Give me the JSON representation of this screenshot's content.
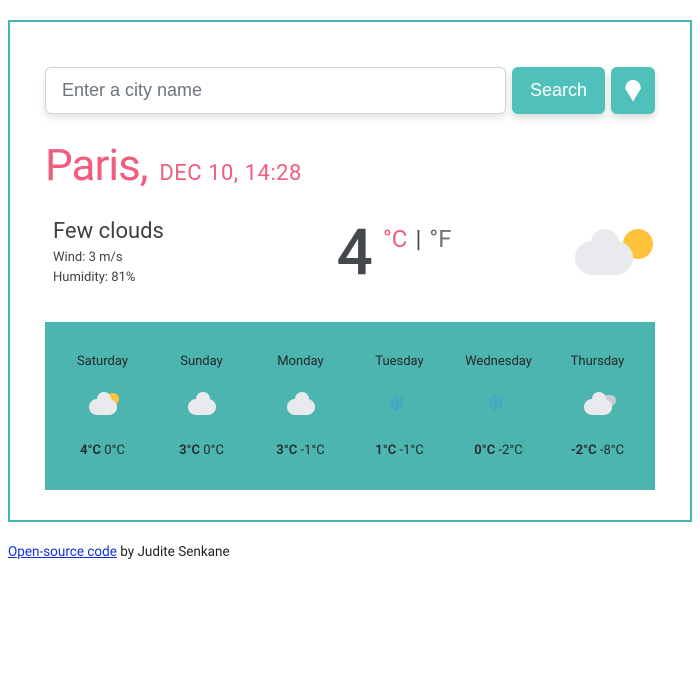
{
  "search": {
    "placeholder": "Enter a city name",
    "button_label": "Search"
  },
  "location": {
    "city": "Paris",
    "datetime": "DEC 10, 14:28"
  },
  "current": {
    "condition": "Few clouds",
    "wind_label": "Wind: 3 m/s",
    "humidity_label": "Humidity: 81%",
    "temperature": "4",
    "unit_c": "°C",
    "unit_separator": "|",
    "unit_f": "°F",
    "icon": "few-clouds"
  },
  "forecast": [
    {
      "day": "Saturday",
      "icon": "cloud-sun",
      "hi": "4°C",
      "lo": "0°C"
    },
    {
      "day": "Sunday",
      "icon": "cloud",
      "hi": "3°C",
      "lo": "0°C"
    },
    {
      "day": "Monday",
      "icon": "cloud",
      "hi": "3°C",
      "lo": "-1°C"
    },
    {
      "day": "Tuesday",
      "icon": "snow",
      "hi": "1°C",
      "lo": "-1°C"
    },
    {
      "day": "Wednesday",
      "icon": "snow",
      "hi": "0°C",
      "lo": "-2°C"
    },
    {
      "day": "Thursday",
      "icon": "cloud-multi",
      "hi": "-2°C",
      "lo": "-8°C"
    }
  ],
  "footer": {
    "link_text": "Open-source code",
    "by_text": " by Judite Senkane"
  },
  "colors": {
    "accent_teal": "#4fc0ba",
    "accent_pink": "#f15d7d",
    "border": "#48b4b0"
  }
}
